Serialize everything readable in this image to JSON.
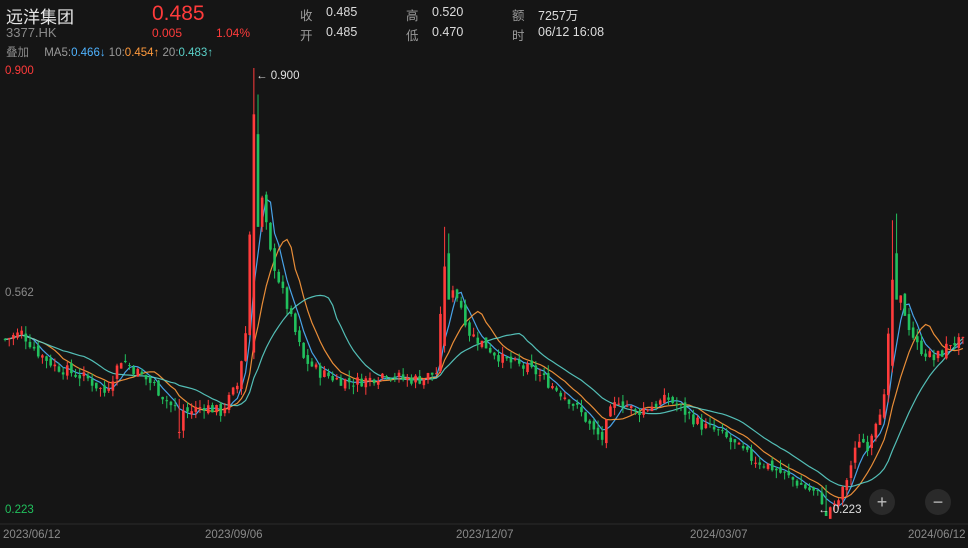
{
  "header": {
    "name": "远洋集团",
    "code": "3377.HK",
    "price": "0.485",
    "change": "0.005",
    "change_pct": "1.04%",
    "overlay_label": "叠加",
    "stats": [
      {
        "label": "收",
        "value": "0.485"
      },
      {
        "label": "高",
        "value": "0.520"
      },
      {
        "label": "额",
        "value": "7257万"
      },
      {
        "label": "开",
        "value": "0.485"
      },
      {
        "label": "低",
        "value": "0.470"
      },
      {
        "label": "时",
        "value": "06/12 16:08"
      }
    ],
    "ma": [
      {
        "label": "MA5",
        "value": "0.466",
        "arrow": "↓"
      },
      {
        "label": "10",
        "value": "0.454",
        "arrow": "↑"
      },
      {
        "label": "20",
        "value": "0.483",
        "arrow": "↑"
      }
    ]
  },
  "colors": {
    "up": "#ff3b3b",
    "down": "#21c05d",
    "ma5": "#4fb3ff",
    "ma10": "#ff9a3c",
    "ma20": "#5ad0c8",
    "background": "#151515"
  },
  "chart_data": {
    "type": "candlestick",
    "ylim": [
      0.223,
      0.9
    ],
    "y_labels": [
      "0.900",
      "0.562",
      "0.223"
    ],
    "x_labels": [
      "2023/06/12",
      "2023/09/06",
      "2023/12/07",
      "2024/03/07",
      "2024/06/12"
    ],
    "annotations": [
      {
        "label": "0.900",
        "type": "max"
      },
      {
        "label": "0.223",
        "type": "min"
      }
    ],
    "series": [
      {
        "name": "MA5",
        "color": "#4fb3ff"
      },
      {
        "name": "MA10",
        "color": "#ff9a3c"
      },
      {
        "name": "MA20",
        "color": "#5ad0c8"
      }
    ],
    "close_path": [
      [
        0,
        0.49
      ],
      [
        4,
        0.5
      ],
      [
        8,
        0.47
      ],
      [
        12,
        0.45
      ],
      [
        16,
        0.44
      ],
      [
        20,
        0.43
      ],
      [
        24,
        0.41
      ],
      [
        28,
        0.46
      ],
      [
        32,
        0.44
      ],
      [
        36,
        0.42
      ],
      [
        40,
        0.39
      ],
      [
        44,
        0.38
      ],
      [
        48,
        0.39
      ],
      [
        52,
        0.38
      ],
      [
        56,
        0.42
      ],
      [
        58,
        0.5
      ],
      [
        60,
        0.8
      ],
      [
        62,
        0.7
      ],
      [
        64,
        0.62
      ],
      [
        66,
        0.58
      ],
      [
        68,
        0.54
      ],
      [
        70,
        0.5
      ],
      [
        72,
        0.46
      ],
      [
        76,
        0.44
      ],
      [
        80,
        0.43
      ],
      [
        84,
        0.425
      ],
      [
        88,
        0.43
      ],
      [
        92,
        0.44
      ],
      [
        96,
        0.43
      ],
      [
        100,
        0.43
      ],
      [
        104,
        0.44
      ],
      [
        106,
        0.6
      ],
      [
        108,
        0.57
      ],
      [
        110,
        0.54
      ],
      [
        112,
        0.5
      ],
      [
        116,
        0.48
      ],
      [
        120,
        0.46
      ],
      [
        124,
        0.45
      ],
      [
        128,
        0.44
      ],
      [
        132,
        0.42
      ],
      [
        136,
        0.4
      ],
      [
        140,
        0.37
      ],
      [
        142,
        0.35
      ],
      [
        144,
        0.34
      ],
      [
        146,
        0.38
      ],
      [
        148,
        0.4
      ],
      [
        150,
        0.39
      ],
      [
        152,
        0.38
      ],
      [
        156,
        0.39
      ],
      [
        160,
        0.4
      ],
      [
        164,
        0.38
      ],
      [
        168,
        0.36
      ],
      [
        172,
        0.35
      ],
      [
        176,
        0.33
      ],
      [
        180,
        0.31
      ],
      [
        184,
        0.3
      ],
      [
        188,
        0.285
      ],
      [
        192,
        0.27
      ],
      [
        196,
        0.255
      ],
      [
        198,
        0.24
      ],
      [
        200,
        0.235
      ],
      [
        202,
        0.26
      ],
      [
        204,
        0.3
      ],
      [
        206,
        0.34
      ],
      [
        208,
        0.33
      ],
      [
        210,
        0.37
      ],
      [
        212,
        0.4
      ],
      [
        214,
        0.58
      ],
      [
        216,
        0.55
      ],
      [
        218,
        0.51
      ],
      [
        220,
        0.48
      ],
      [
        222,
        0.47
      ],
      [
        224,
        0.46
      ],
      [
        226,
        0.47
      ],
      [
        228,
        0.485
      ],
      [
        230,
        0.485
      ]
    ],
    "spikes": [
      [
        60,
        0.83,
        0.9,
        0.46,
        "up"
      ],
      [
        61,
        0.8,
        0.86,
        0.66,
        "down"
      ],
      [
        106,
        0.6,
        0.66,
        0.47,
        "up"
      ],
      [
        107,
        0.62,
        0.65,
        0.55,
        "down"
      ],
      [
        214,
        0.58,
        0.67,
        0.44,
        "up"
      ],
      [
        215,
        0.62,
        0.68,
        0.55,
        "down"
      ],
      [
        42,
        0.35,
        0.4,
        0.34,
        "up"
      ],
      [
        198,
        0.23,
        0.27,
        0.223,
        "down"
      ]
    ]
  },
  "controls": {
    "zoom_in": "+",
    "zoom_out": "−"
  }
}
